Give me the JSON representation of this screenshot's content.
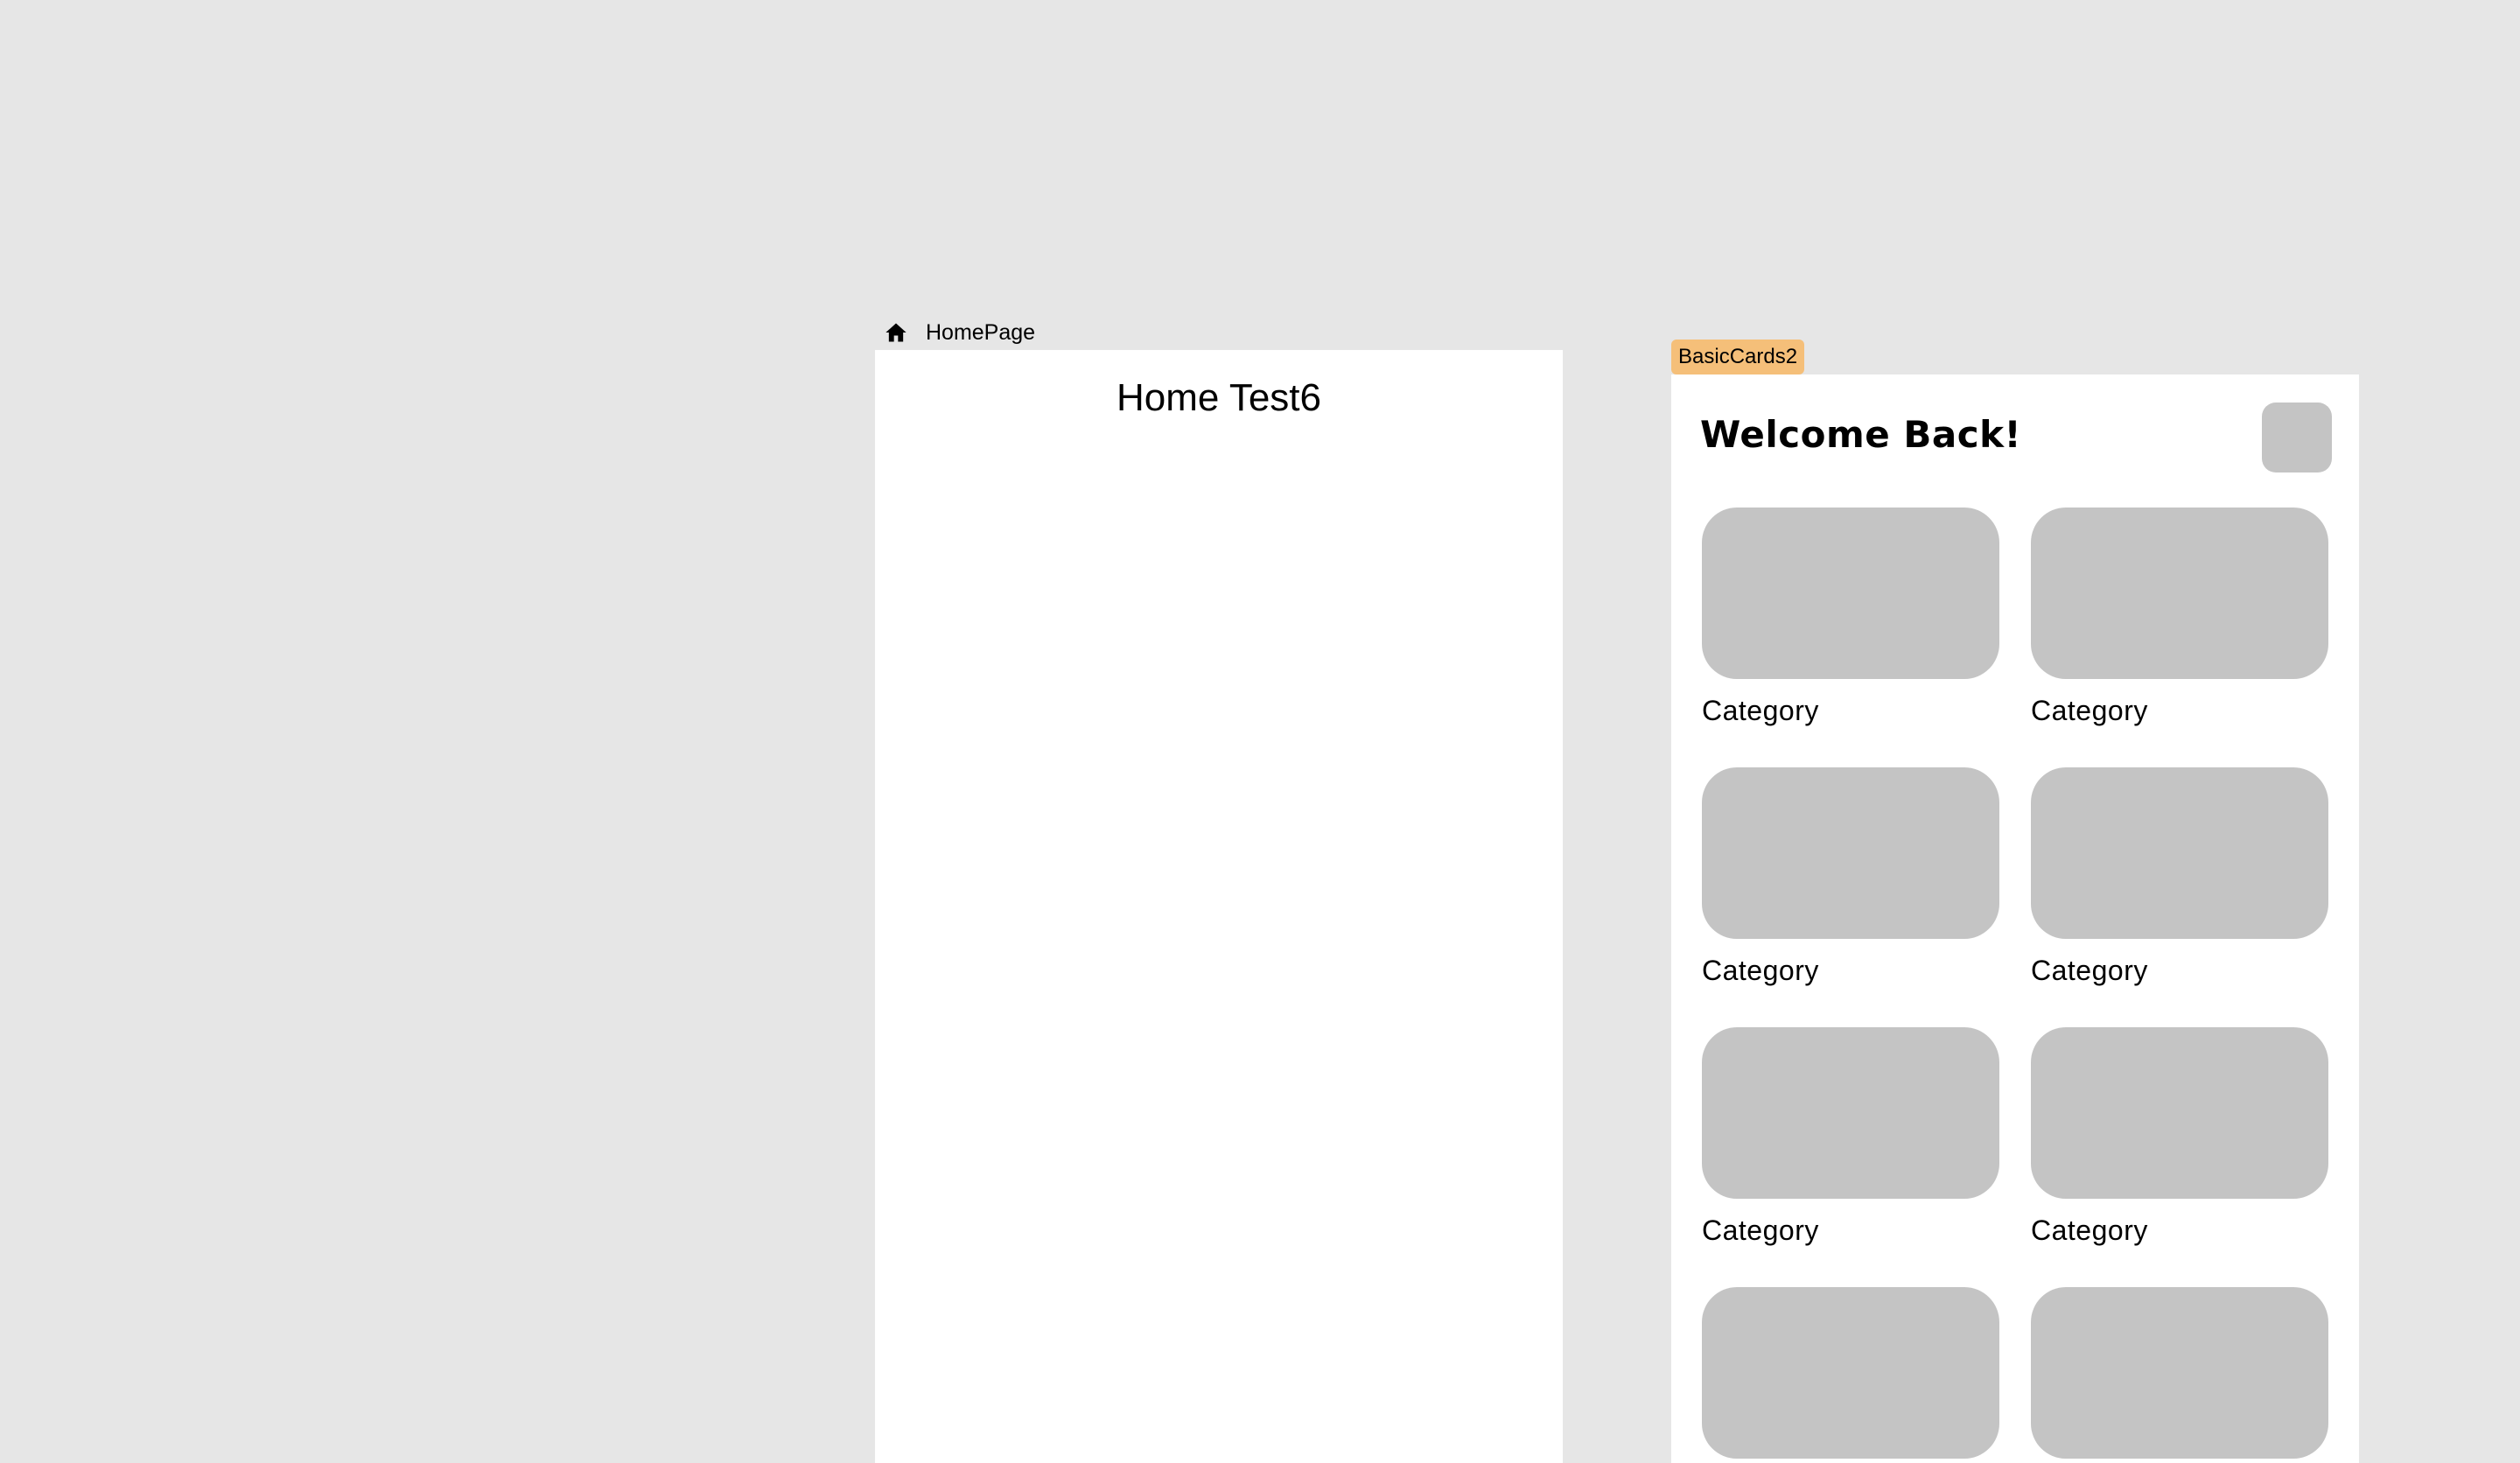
{
  "homepage_frame": {
    "label": "HomePage",
    "icon": "home-icon",
    "title": "Home Test6"
  },
  "basic_cards_frame": {
    "tag": "BasicCards2",
    "tag_color": "#f5bf79",
    "heading": "Welcome Back!",
    "cards": [
      {
        "label": "Category"
      },
      {
        "label": "Category"
      },
      {
        "label": "Category"
      },
      {
        "label": "Category"
      },
      {
        "label": "Category"
      },
      {
        "label": "Category"
      },
      {
        "label": ""
      },
      {
        "label": ""
      }
    ]
  },
  "colors": {
    "canvas_bg": "#e6e6e6",
    "frame_bg": "#ffffff",
    "placeholder": "#c4c4c4"
  }
}
